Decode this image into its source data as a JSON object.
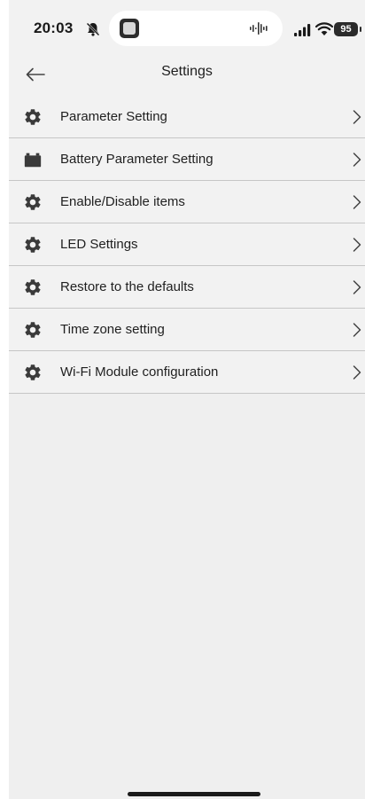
{
  "status_bar": {
    "time": "20:03",
    "battery": "95",
    "icons": [
      "bell-off-icon",
      "app-thumb-icon",
      "waveform-icon",
      "cell-signal-icon",
      "wifi-icon"
    ]
  },
  "nav": {
    "title": "Settings",
    "back_icon": "arrow-left-icon"
  },
  "menu": {
    "items": [
      {
        "label": "Parameter Setting",
        "icon": "gear-icon"
      },
      {
        "label": "Battery Parameter Setting",
        "icon": "battery-icon"
      },
      {
        "label": "Enable/Disable items",
        "icon": "gear-icon"
      },
      {
        "label": "LED Settings",
        "icon": "gear-icon"
      },
      {
        "label": "Restore to the defaults",
        "icon": "gear-icon"
      },
      {
        "label": "Time zone setting",
        "icon": "gear-icon"
      },
      {
        "label": "Wi-Fi Module configuration",
        "icon": "gear-icon"
      }
    ],
    "chevron_icon": "chevron-right-icon"
  },
  "colors": {
    "background": "#efefef",
    "text": "#1e1e1e",
    "icon": "#3a3a3a",
    "divider": "#c6c6c6"
  }
}
